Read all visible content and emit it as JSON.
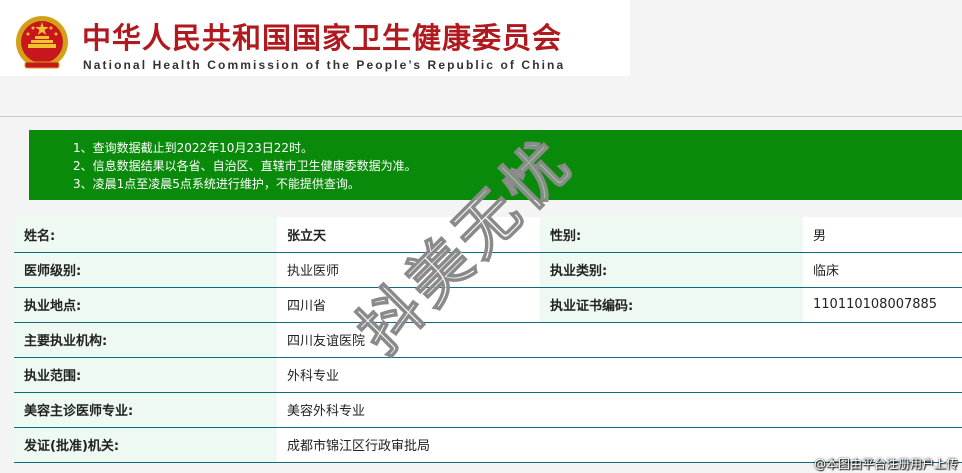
{
  "header": {
    "title_cn": "中华人民共和国国家卫生健康委员会",
    "title_en": "National Health Commission of the People’s Republic of China",
    "emblem_icon": "national-emblem-icon"
  },
  "notice": {
    "lines": [
      "1、查询数据截止到2022年10月23日22时。",
      "2、信息数据结果以各省、自治区、直辖市卫生健康委数据为准。",
      "3、凌晨1点至凌晨5点系统进行维护，不能提供查询。"
    ],
    "background": "#0a8a0a"
  },
  "table": {
    "rows": [
      {
        "label1": "姓名:",
        "value1": "张立天",
        "label2": "性别:",
        "value2": "男"
      },
      {
        "label1": "医师级别:",
        "value1": "执业医师",
        "label2": "执业类别:",
        "value2": "临床"
      },
      {
        "label1": "执业地点:",
        "value1": "四川省",
        "label2": "执业证书编码:",
        "value2": "110110108007885"
      },
      {
        "label1": "主要执业机构:",
        "value1": "四川友谊医院"
      },
      {
        "label1": "执业范围:",
        "value1": "外科专业"
      },
      {
        "label1": "美容主诊医师专业:",
        "value1": "美容外科专业"
      },
      {
        "label1": "发证(批准)机关:",
        "value1": "成都市锦江区行政审批局"
      }
    ]
  },
  "watermark": {
    "text": "抖美无忧"
  },
  "footnote": {
    "text": "@本图由平台注册用户上传"
  },
  "colors": {
    "brand_red": "#b0191e",
    "row_border": "#0e6b7b",
    "label_bg": "#eef9f2"
  }
}
